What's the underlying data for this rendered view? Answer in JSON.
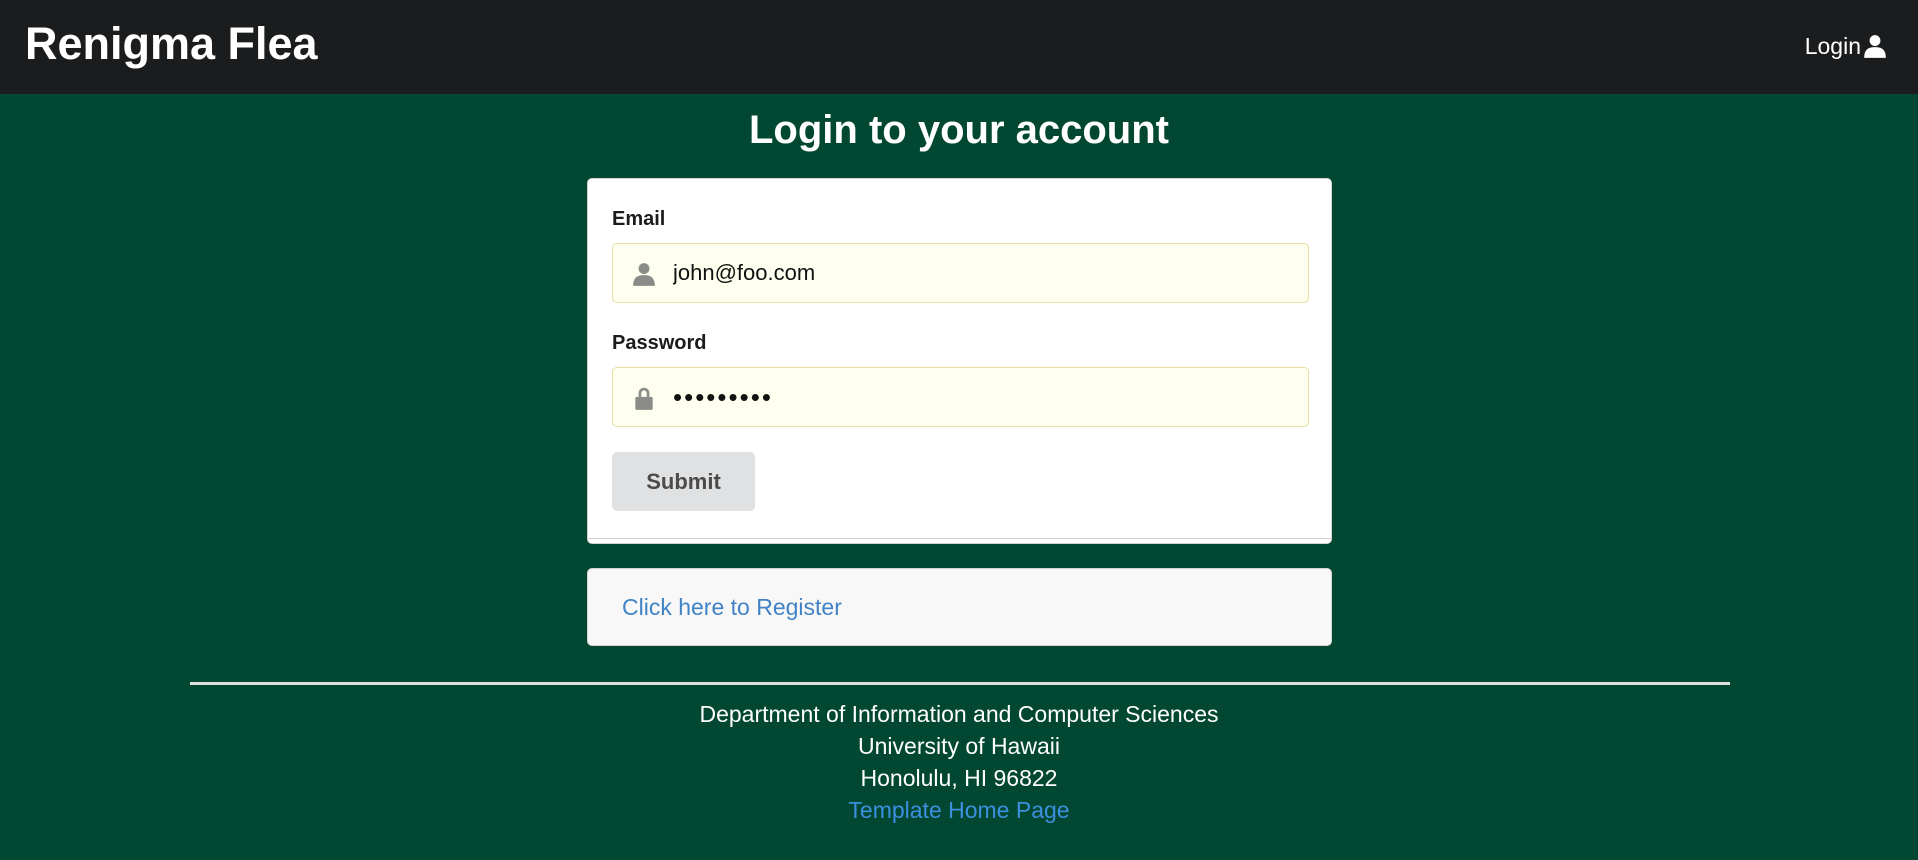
{
  "navbar": {
    "brand": "Renigma Flea",
    "login_label": "Login",
    "login_icon": "user-icon"
  },
  "page": {
    "title": "Login to your account"
  },
  "login_form": {
    "email": {
      "label": "Email",
      "value": "john@foo.com",
      "icon": "user-icon"
    },
    "password": {
      "label": "Password",
      "value": "•••••••••",
      "icon": "lock-icon"
    },
    "submit_label": "Submit"
  },
  "register": {
    "link_text": "Click here to Register"
  },
  "footer": {
    "line1": "Department of Information and Computer Sciences",
    "line2": "University of Hawaii",
    "line3": "Honolulu, HI 96822",
    "link_text": "Template Home Page"
  },
  "colors": {
    "page_background": "#024731",
    "navbar_background": "#1b1c1d",
    "link": "#4183c4",
    "input_background": "#fffff0"
  }
}
